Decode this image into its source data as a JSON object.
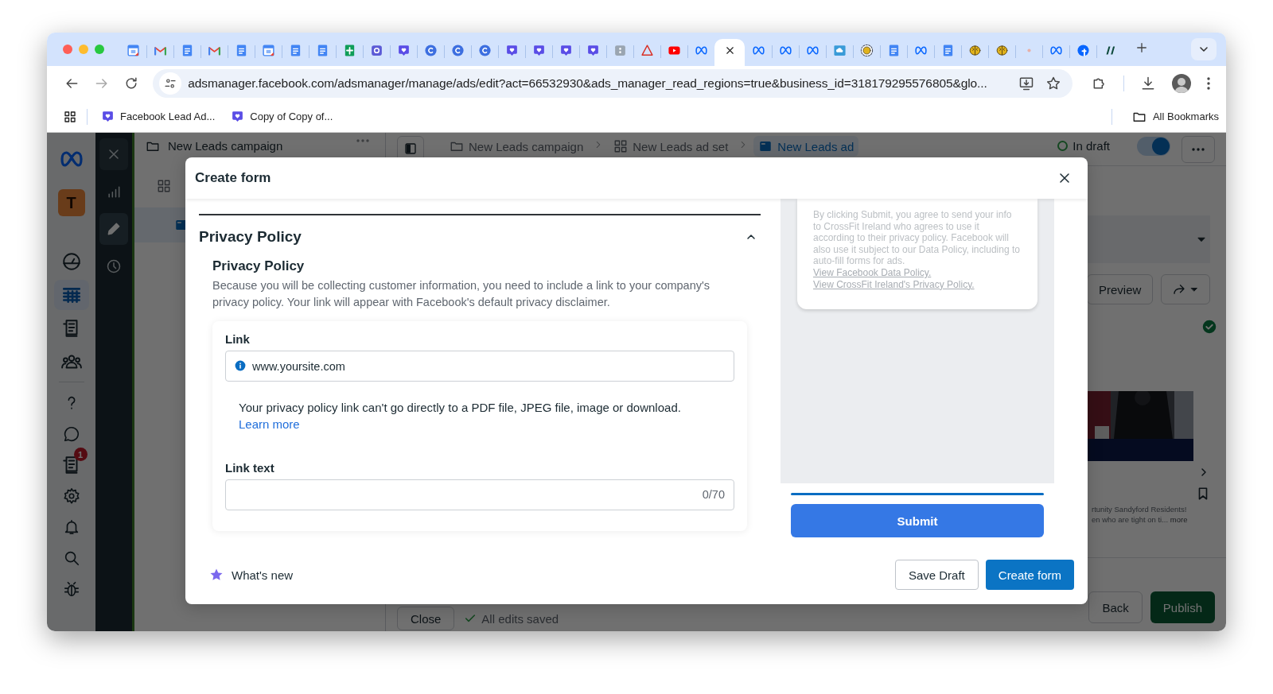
{
  "browser": {
    "tabs": [
      {
        "kind": "calendar",
        "selected": false
      },
      {
        "kind": "mail",
        "selected": false
      },
      {
        "kind": "doc",
        "selected": false
      },
      {
        "kind": "mail",
        "selected": false
      },
      {
        "kind": "doc",
        "selected": false
      },
      {
        "kind": "calendar",
        "selected": false
      },
      {
        "kind": "doc",
        "selected": false
      },
      {
        "kind": "doc",
        "selected": false
      },
      {
        "kind": "sheet",
        "selected": false
      },
      {
        "kind": "app",
        "selected": false
      },
      {
        "kind": "heart",
        "selected": false
      },
      {
        "kind": "c",
        "selected": false
      },
      {
        "kind": "c",
        "selected": false
      },
      {
        "kind": "c",
        "selected": false
      },
      {
        "kind": "heart",
        "selected": false
      },
      {
        "kind": "heart",
        "selected": false
      },
      {
        "kind": "heart",
        "selected": false
      },
      {
        "kind": "heart",
        "selected": false
      },
      {
        "kind": "grayapp",
        "selected": false
      },
      {
        "kind": "triangle",
        "selected": false
      },
      {
        "kind": "video",
        "selected": false
      },
      {
        "kind": "meta",
        "selected": false
      },
      {
        "selected": true
      },
      {
        "kind": "meta",
        "selected": false
      },
      {
        "kind": "meta",
        "selected": false
      },
      {
        "kind": "meta",
        "selected": false
      },
      {
        "kind": "cloud",
        "selected": false
      },
      {
        "kind": "braincircle",
        "selected": false
      },
      {
        "kind": "doc",
        "selected": false
      },
      {
        "kind": "meta",
        "selected": false
      },
      {
        "kind": "doc",
        "selected": false
      },
      {
        "kind": "brain",
        "selected": false
      },
      {
        "kind": "brain",
        "selected": false
      },
      {
        "kind": "blank",
        "selected": false
      },
      {
        "kind": "meta",
        "selected": false
      },
      {
        "kind": "fb",
        "selected": false
      },
      {
        "kind": "stripes",
        "selected": false
      }
    ],
    "url": "adsmanager.facebook.com/adsmanager/manage/ads/edit?act=66532930&ads_manager_read_regions=true&business_id=318179295576805&glo...",
    "bookmarks": [
      "Facebook Lead Ad...",
      "Copy of Copy of..."
    ],
    "all_bookmarks": "All Bookmarks"
  },
  "rail": {
    "avatar": "T",
    "items": [
      {
        "kind": "gauge",
        "selected": false
      },
      {
        "kind": "table",
        "selected": true
      },
      {
        "kind": "news",
        "selected": false
      },
      {
        "kind": "people",
        "selected": false
      }
    ],
    "help_items": [
      {
        "kind": "question"
      },
      {
        "kind": "chat"
      },
      {
        "kind": "news",
        "badge": "1"
      },
      {
        "kind": "gear"
      },
      {
        "kind": "bell"
      },
      {
        "kind": "search"
      },
      {
        "kind": "bug"
      }
    ]
  },
  "tools": [
    {
      "kind": "close",
      "selected": false
    },
    {
      "kind": "chart",
      "selected": false
    },
    {
      "kind": "pencil",
      "selected": true
    },
    {
      "kind": "clock",
      "selected": false
    }
  ],
  "tree": {
    "campaign": "New Leads campaign"
  },
  "header": {
    "breadcrumbs": [
      {
        "kind": "campaign",
        "label": "New Leads campaign",
        "selected": false
      },
      {
        "kind": "ad_set",
        "label": "New Leads ad set",
        "selected": false
      },
      {
        "kind": "ad",
        "label": "New Leads ad",
        "selected": true
      }
    ],
    "status": "In draft",
    "toggle_on": true
  },
  "ad_preview": {
    "preview_button": "Preview",
    "text_lines": [
      "rtunity Sandyford Residents!",
      "en who are tight on ti..."
    ],
    "more": "more"
  },
  "footer": {
    "close": "Close",
    "saved": "All edits saved",
    "back": "Back",
    "publish": "Publish"
  },
  "modal": {
    "title": "Create form",
    "section": {
      "title": "Privacy Policy",
      "expanded": true,
      "subtitle": "Privacy Policy",
      "description": "Because you will be collecting customer information, you need to include a link to your company's privacy policy. Your link will appear with Facebook's default privacy disclaimer.",
      "link": {
        "label": "Link",
        "value": "www.yoursite.com",
        "note": "Your privacy policy link can't go directly to a PDF file, JPEG file, image or download.",
        "learn_more": "Learn more"
      },
      "link_text": {
        "label": "Link text",
        "counter": "0/70"
      }
    },
    "preview": {
      "disclaimer": "By clicking Submit, you agree to send your info to CrossFit Ireland who agrees to use it according to their privacy policy. Facebook will also use it subject to our Data Policy, including to auto-fill forms for ads.",
      "links": [
        "View Facebook Data Policy.",
        "View CrossFit Ireland's Privacy Policy."
      ],
      "submit": "Submit"
    },
    "whats_new": "What's new",
    "buttons": [
      {
        "kind": "secondary",
        "label": "Save Draft"
      },
      {
        "kind": "primary",
        "label": "Create form"
      }
    ]
  }
}
